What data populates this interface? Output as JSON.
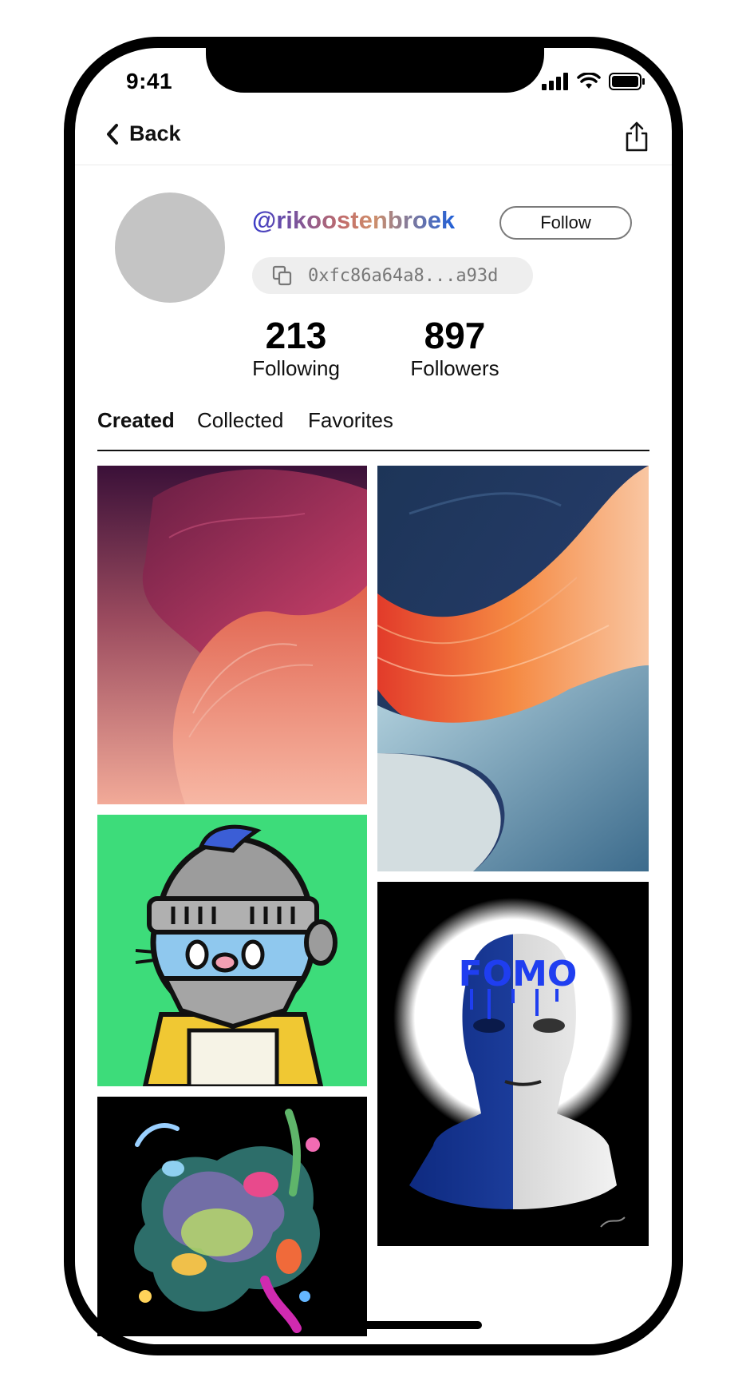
{
  "status_bar": {
    "time": "9:41"
  },
  "nav": {
    "back_label": "Back"
  },
  "profile": {
    "username": "@rikoostenbroek",
    "follow_label": "Follow",
    "wallet_address": "0xfc86a64a8...a93d",
    "stats": [
      {
        "value": "213",
        "label": "Following"
      },
      {
        "value": "897",
        "label": "Followers"
      }
    ]
  },
  "tabs": [
    {
      "label": "Created",
      "active": true
    },
    {
      "label": "Collected",
      "active": false
    },
    {
      "label": "Favorites",
      "active": false
    }
  ],
  "gallery": {
    "fomo_text": "FOMO"
  },
  "colors": {
    "gradient_start": "#3a3cc9",
    "gradient_mid": "#cf8f6b",
    "gradient_end": "#1f5fd8",
    "avatar_placeholder": "#c4c4c4",
    "green_tile": "#3ddc7a"
  }
}
